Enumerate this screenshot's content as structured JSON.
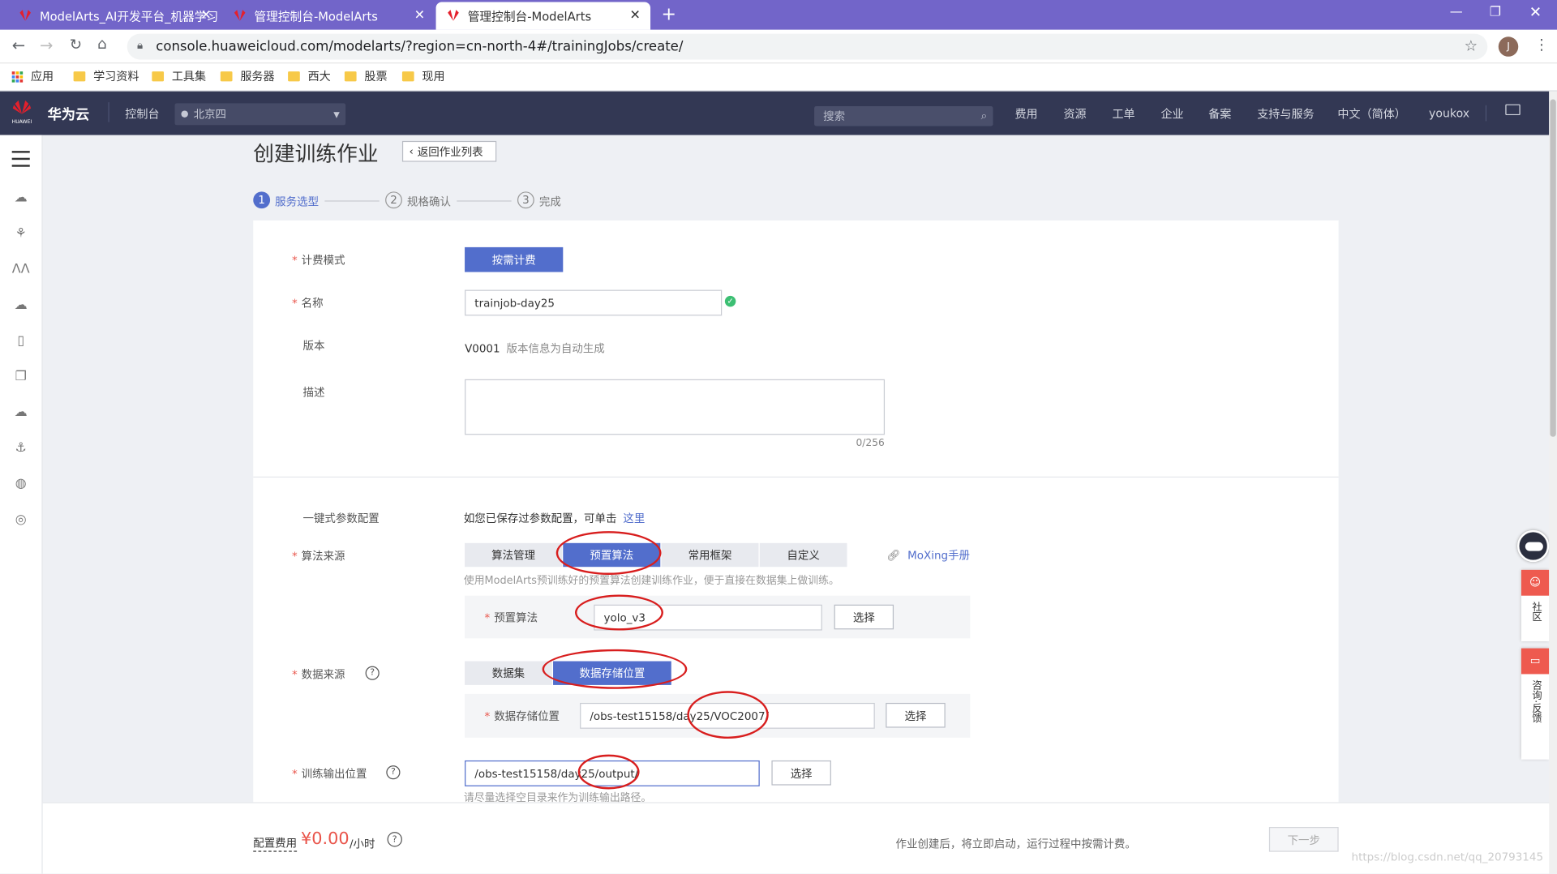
{
  "browser": {
    "tabs": [
      {
        "label": "ModelArts_AI开发平台_机器学习",
        "active": false
      },
      {
        "label": "管理控制台-ModelArts",
        "active": false
      },
      {
        "label": "管理控制台-ModelArts",
        "active": true
      }
    ],
    "url": "console.huaweicloud.com/modelarts/?region=cn-north-4#/trainingJobs/create/",
    "profile_initial": "J",
    "bookmarks": [
      "应用",
      "学习资料",
      "工具集",
      "服务器",
      "西大",
      "股票",
      "现用"
    ]
  },
  "header": {
    "brand_small": "HUAWEI",
    "brand": "华为云",
    "console": "控制台",
    "region": "北京四",
    "search_placeholder": "搜索",
    "nav": [
      "费用",
      "资源",
      "工单",
      "企业",
      "备案",
      "支持与服务",
      "中文（简体）",
      "youkox"
    ]
  },
  "page": {
    "title": "创建训练作业",
    "back_button": "返回作业列表",
    "steps": [
      {
        "num": "1",
        "label": "服务选型",
        "active": true
      },
      {
        "num": "2",
        "label": "规格确认",
        "active": false
      },
      {
        "num": "3",
        "label": "完成",
        "active": false
      }
    ]
  },
  "form": {
    "billing_label": "计费模式",
    "billing_value": "按需计费",
    "name_label": "名称",
    "name_value": "trainjob-day25",
    "version_label": "版本",
    "version_value": "V0001",
    "version_hint": "版本信息为自动生成",
    "desc_label": "描述",
    "desc_counter": "0/256",
    "quick_label": "一键式参数配置",
    "quick_text": "如您已保存过参数配置，可单击",
    "quick_link": "这里",
    "algo_label": "算法来源",
    "algo_tabs": [
      "算法管理",
      "预置算法",
      "常用框架",
      "自定义"
    ],
    "algo_active": 1,
    "moxing_link": "MoXing手册",
    "algo_hint": "使用ModelArts预训练好的预置算法创建训练作业，便于直接在数据集上做训练。",
    "preset_label": "预置算法",
    "preset_value": "yolo_v3",
    "select_btn": "选择",
    "data_label": "数据来源",
    "data_tabs": [
      "数据集",
      "数据存储位置"
    ],
    "data_active": 1,
    "storage_label": "数据存储位置",
    "storage_value": "/obs-test15158/day25/VOC2007/",
    "output_label": "训练输出位置",
    "output_value": "/obs-test15158/day25/output/",
    "output_hint": "请尽量选择空目录来作为训练输出路径。"
  },
  "footer": {
    "cost_label": "配置费用",
    "cost_value": "¥0.00",
    "cost_unit": "/小时",
    "note": "作业创建后，将立即启动，运行过程中按需计费。",
    "next_button": "下一步",
    "watermark": "https://blog.csdn.net/qq_20793145"
  },
  "floating": {
    "community": "社区",
    "feedback": "咨询·反馈"
  },
  "colors": {
    "tabbar": "#7265c9",
    "header": "#333854",
    "primary": "#526ecc",
    "required": "#e9544a",
    "annotation": "#d81e1e"
  }
}
